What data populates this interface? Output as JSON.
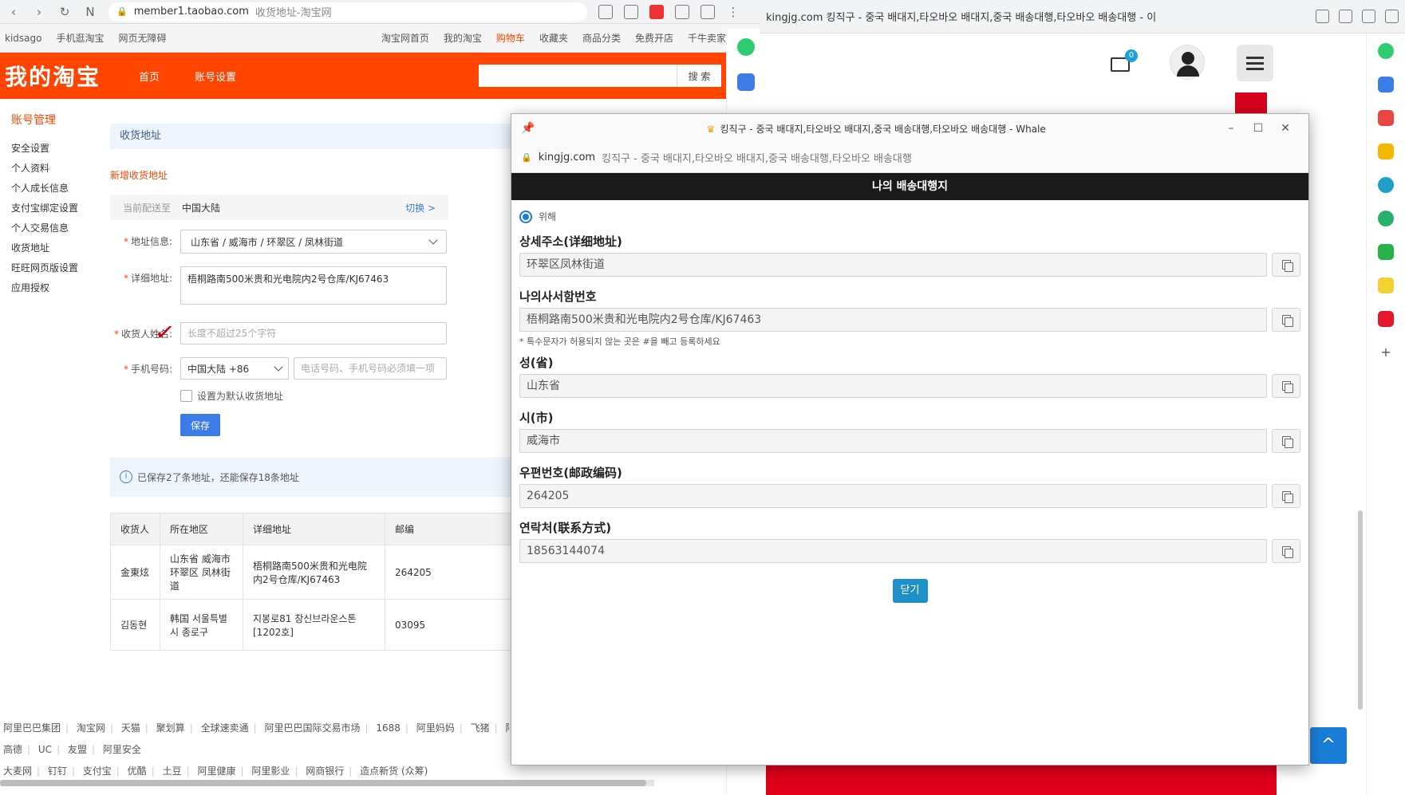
{
  "left_browser": {
    "url_domain": "member1.taobao.com",
    "url_title": "收货地址-淘宝网",
    "topbar": {
      "left": [
        "kidsago",
        "手机逛淘宝",
        "网页无障碍"
      ],
      "right": [
        "淘宝网首页",
        "我的淘宝",
        "购物车",
        "收藏夹",
        "商品分类",
        "免费开店",
        "千牛卖家中心"
      ]
    },
    "header": {
      "logo": "我的淘宝",
      "nav_home": "首页",
      "nav_account": "账号设置",
      "search_button": "搜 索"
    },
    "sidebar": {
      "title": "账号管理",
      "items": [
        "安全设置",
        "个人资料",
        "个人成长信息",
        "支付宝绑定设置",
        "个人交易信息",
        "收货地址",
        "旺旺网页版设置",
        "应用授权"
      ]
    },
    "main": {
      "panel_title": "收货地址",
      "new_address": "新增收货地址",
      "deliver_label": "当前配送至",
      "deliver_value": "中国大陆",
      "switch": "切换 >",
      "address_label": "地址信息:",
      "address_value": "山东省 / 威海市 / 环翠区 / 凤林街道",
      "detail_label": "详细地址:",
      "detail_value": "梧桐路南500米贵和光电院内2号仓库/KJ67463",
      "name_label": "收货人姓名:",
      "name_placeholder": "长度不超过25个字符",
      "phone_label": "手机号码:",
      "phone_code": "中国大陆 +86",
      "phone_placeholder": "电话号码、手机号码必须填一项",
      "default_label": "设置为默认收货地址",
      "save": "保存",
      "info": "已保存2了条地址，还能保存18条地址"
    },
    "table": {
      "headers": [
        "收货人",
        "所在地区",
        "详细地址",
        "邮编"
      ],
      "rows": [
        [
          "金東炫",
          "山东省 威海市 环翠区 凤林街道",
          "梧桐路南500米贵和光电院内2号仓库/KJ67463",
          "264205"
        ],
        [
          "김동현",
          "韩国 서울특별시 종로구",
          "지봉로81 창신브라운스톤 [1202호]",
          "03095"
        ]
      ]
    },
    "footer": [
      [
        "阿里巴巴集团",
        "淘宝网",
        "天猫",
        "聚划算",
        "全球速卖通",
        "阿里巴巴国际交易市场",
        "1688",
        "阿里妈妈",
        "飞猪",
        "阿里"
      ],
      [
        "高德",
        "UC",
        "友盟",
        "阿里安全"
      ],
      [
        "大麦网",
        "钉钉",
        "支付宝",
        "优酷",
        "土豆",
        "阿里健康",
        "阿里影业",
        "网商银行",
        "造点新货 (众筹)"
      ]
    ]
  },
  "right_browser": {
    "tab_title": "kingjg.com 킹직구 - 중국 배대지,타오바오 배대지,중국 배송대행,타오바오 배송대행 - 이",
    "mail_badge": "0",
    "up_arrow": "^"
  },
  "popup": {
    "title": "킹직구 - 중국 배대지,타오바오 배대지,중국 배송대행,타오바오 배송대행 - Whale",
    "url_domain": "kingjg.com",
    "url_title": "킹직구 - 중국 배대지,타오바오 배대지,중국 배송대행,타오바오 배송대행",
    "header": "나의 배송대행지",
    "radio_label": "위해",
    "fields": [
      {
        "label": "상세주소(详细地址)",
        "value": "环翠区凤林街道"
      },
      {
        "label": "나의사서함번호",
        "value": "梧桐路南500米贵和光电院内2号仓库/KJ67463",
        "note": "* 특수문자가 허용되지 않는 곳은 #을 빼고 등록하세요"
      },
      {
        "label": "성(省)",
        "value": "山东省"
      },
      {
        "label": "시(市)",
        "value": "威海市"
      },
      {
        "label": "우편번호(邮政编码)",
        "value": "264205"
      },
      {
        "label": "연락처(联系方式)",
        "value": "18563144074"
      }
    ],
    "close_button": "닫기"
  },
  "colors": {
    "taobao_orange": "#ff4400",
    "save_blue": "#3c7ce8",
    "close_blue": "#1e8fc7"
  }
}
